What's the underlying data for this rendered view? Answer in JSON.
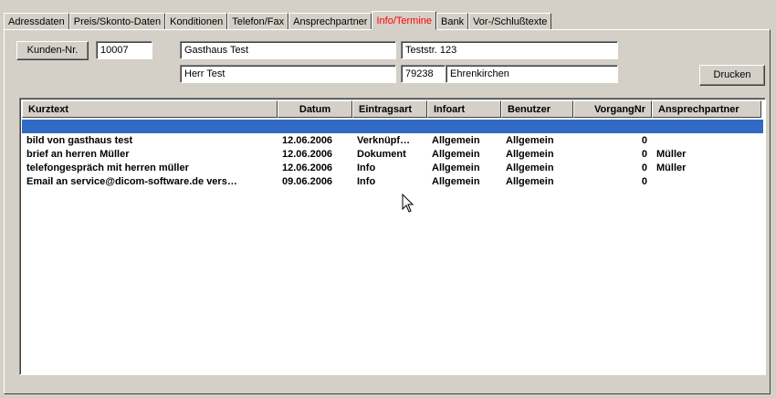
{
  "tabs": [
    {
      "label": "Adressdaten",
      "active": false
    },
    {
      "label": "Preis/Skonto-Daten",
      "active": false
    },
    {
      "label": "Konditionen",
      "active": false
    },
    {
      "label": "Telefon/Fax",
      "active": false
    },
    {
      "label": "Ansprechpartner",
      "active": false
    },
    {
      "label": "Info/Termine",
      "active": true
    },
    {
      "label": "Bank",
      "active": false
    },
    {
      "label": "Vor-/Schlußtexte",
      "active": false
    }
  ],
  "customer": {
    "number_button_label": "Kunden-Nr.",
    "number": "10007",
    "name": "Gasthaus Test",
    "contact": "Herr Test",
    "street": "Teststr. 123",
    "zip": "79238",
    "city": "Ehrenkirchen"
  },
  "print_button_label": "Drucken",
  "table": {
    "columns": [
      "Kurztext",
      "Datum",
      "Eintragsart",
      "Infoart",
      "Benutzer",
      "VorgangNr",
      "Ansprechpartner"
    ],
    "rows": [
      [
        "bild von gasthaus test",
        "12.06.2006",
        "Verknüpf…",
        "Allgemein",
        "Allgemein",
        "0",
        ""
      ],
      [
        "brief an herren Müller",
        "12.06.2006",
        "Dokument",
        "Allgemein",
        "Allgemein",
        "0",
        "Müller"
      ],
      [
        "telefongespräch mit herren müller",
        "12.06.2006",
        "Info",
        "Allgemein",
        "Allgemein",
        "0",
        "Müller"
      ],
      [
        "Email an service@dicom-software.de vers…",
        "09.06.2006",
        "Info",
        "Allgemein",
        "Allgemein",
        "0",
        ""
      ]
    ]
  },
  "colors": {
    "active_tab": "#ff0000",
    "selection": "#316ac5",
    "window_bg": "#d4d0c8"
  },
  "icons": {
    "cursor": "mouse-pointer-icon"
  }
}
